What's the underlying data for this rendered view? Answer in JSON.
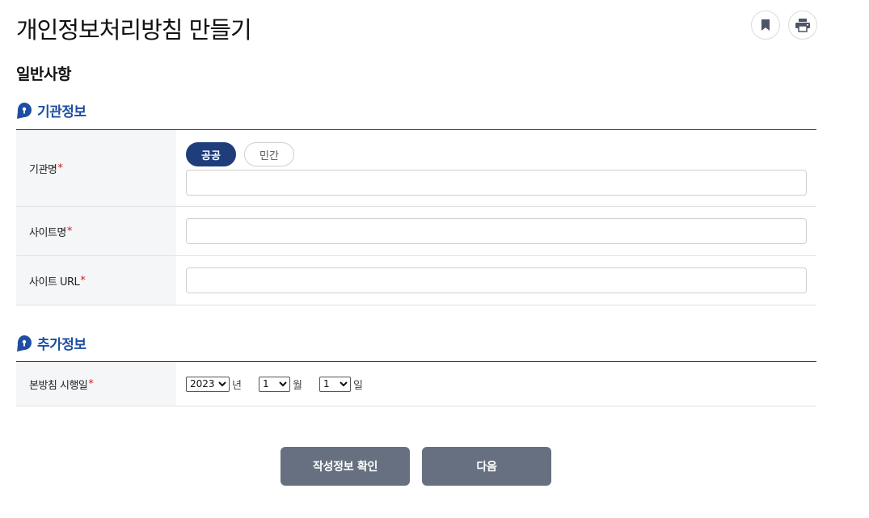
{
  "page": {
    "title": "개인정보처리방침 만들기",
    "bookmark_icon": "bookmark-icon",
    "print_icon": "print-icon"
  },
  "section": {
    "heading": "일반사항"
  },
  "org_group": {
    "title": "기관정보",
    "icon": "pin-icon",
    "rows": {
      "org_name": {
        "label": "기관명",
        "required_mark": "*",
        "toggle": {
          "public_label": "공공",
          "private_label": "민간",
          "selected": "공공"
        },
        "value": "",
        "placeholder": ""
      },
      "site_name": {
        "label": "사이트명",
        "required_mark": "*",
        "value": "",
        "placeholder": ""
      },
      "site_url": {
        "label": "사이트 URL",
        "required_mark": "*",
        "value": "",
        "placeholder": ""
      }
    }
  },
  "extra_group": {
    "title": "추가정보",
    "icon": "pin-icon",
    "rows": {
      "effective_date": {
        "label": "본방침 시행일",
        "required_mark": "*",
        "year": "2023",
        "year_unit": "년",
        "month": "1",
        "month_unit": "월",
        "day": "1",
        "day_unit": "일"
      }
    }
  },
  "actions": {
    "confirm_label": "작성정보 확인",
    "next_label": "다음"
  },
  "colors": {
    "accent": "#1d4ea3",
    "toggle_active": "#1f3d7a",
    "required": "#d21c1c",
    "button": "#677080"
  }
}
